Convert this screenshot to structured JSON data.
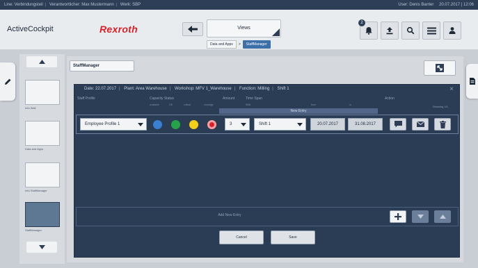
{
  "status_bar": {
    "left_items": [
      "Line: Verbindungsteil",
      "Verantwortlicher: Max Mustermann",
      "Werk: SBP"
    ],
    "user": "User: Denis Barrier",
    "datetime": "20.07.2017 | 12:06"
  },
  "header": {
    "app_name": "ActiveCockpit",
    "brand": "Rexroth",
    "views_label": "Views",
    "breadcrumb": [
      "Data and Apps",
      "StaffManager"
    ],
    "breadcrumb_sep": ">",
    "notification_count": "2"
  },
  "thumbnails": [
    {
      "caption": "Info Wall"
    },
    {
      "caption": "Data and Apps"
    },
    {
      "caption": "Info StaffManager"
    },
    {
      "caption": "StaffManager"
    }
  ],
  "panel": {
    "title": "StaffManager",
    "info": {
      "date": "Date: 22.07.2017",
      "plant": "Plant: Area Warehouse",
      "workshop": "Workshop: MFV 1_Warehouse",
      "function": "Function: Milling",
      "shift": "Shift 1"
    },
    "columns": {
      "staff_profile": "Staff Profile",
      "capacity_status": "Capacity Status",
      "amount": "Amount",
      "time_span": "Time Span",
      "action": "Action",
      "showing": "Showing 1/1"
    },
    "capacity_sub": [
      "available",
      "OK",
      "critical",
      "shortage"
    ],
    "timespan_sub": [
      "Shift",
      "from",
      "to"
    ],
    "new_entry_label": "New Entry",
    "row": {
      "profile": "Employee Profile 1",
      "amount": "3",
      "shift": "Shift 1",
      "from": "20.07.2017",
      "to": "31.08.2017"
    },
    "add_new_entry": "Add New Entry",
    "cancel": "Cancel",
    "save": "Save"
  },
  "colors": {
    "dot_blue": "#3a7fd0",
    "dot_green": "#28a24a",
    "dot_yellow": "#f2d01a",
    "dot_red": "#d8222a",
    "panel_dark": "#2b3c55",
    "accent": "#3d6fa8"
  },
  "icons": [
    "arrow-left-icon",
    "bell-icon",
    "upload-icon",
    "search-icon",
    "menu-icon",
    "user-icon",
    "expand-icon",
    "chat-icon",
    "mail-icon",
    "trash-icon",
    "plus-icon",
    "chevron-down-icon",
    "chevron-up-icon",
    "pencil-icon",
    "document-icon"
  ]
}
